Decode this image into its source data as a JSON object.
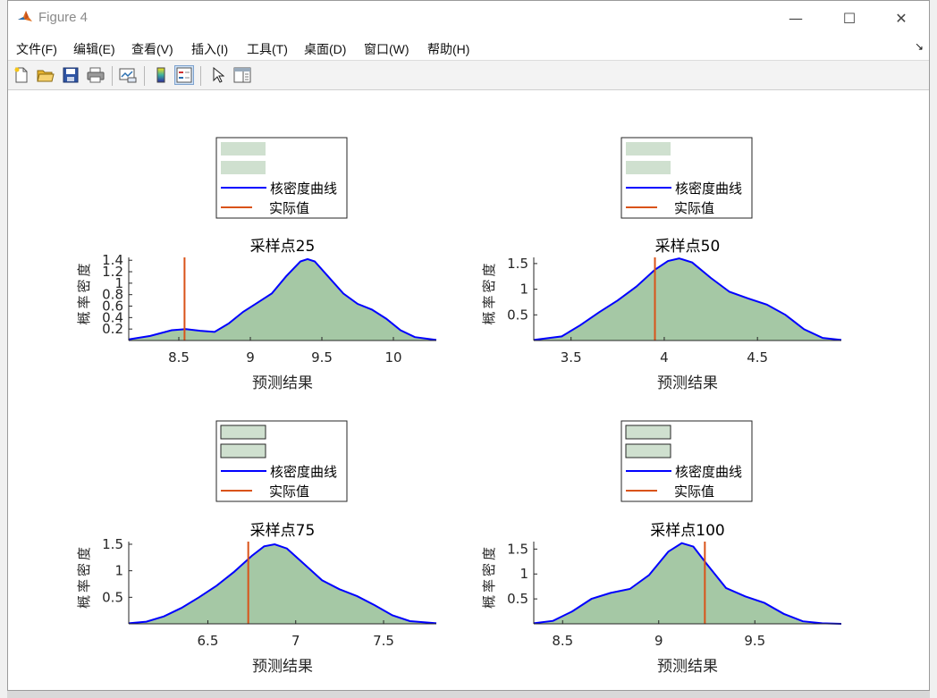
{
  "window": {
    "title": "Figure 4",
    "minimize_glyph": "—",
    "maximize_glyph": "☐",
    "close_glyph": "✕"
  },
  "menu": [
    {
      "label": "文件(F)"
    },
    {
      "label": "编辑(E)"
    },
    {
      "label": "查看(V)"
    },
    {
      "label": "插入(I)"
    },
    {
      "label": "工具(T)"
    },
    {
      "label": "桌面(D)"
    },
    {
      "label": "窗口(W)"
    },
    {
      "label": "帮助(H)"
    }
  ],
  "menu_dock_arrow": "↘",
  "toolbar": [
    {
      "name": "new-figure-icon"
    },
    {
      "name": "open-file-icon"
    },
    {
      "name": "save-icon"
    },
    {
      "name": "print-icon"
    },
    {
      "name": "link-plot-icon"
    },
    {
      "name": "colorbar-icon"
    },
    {
      "name": "legend-icon"
    },
    {
      "name": "pointer-icon"
    },
    {
      "name": "property-inspector-icon"
    }
  ],
  "legend": {
    "kde_label": "核密度曲线",
    "actual_label": "实际值"
  },
  "colors": {
    "kde": "#0000ff",
    "actual": "#d95319",
    "fill": "#a5c8a5",
    "legend_patch": "#cfe0cf"
  },
  "chart_data": [
    {
      "type": "area",
      "title": "采样点25",
      "xlabel": "预测结果",
      "ylabel": "概率密度",
      "xlim": [
        8.15,
        10.3
      ],
      "ylim": [
        0,
        1.45
      ],
      "xticks": [
        8.5,
        9,
        9.5,
        10
      ],
      "xtick_labels": [
        "8.5",
        "9",
        "9.5",
        "10"
      ],
      "yticks": [
        0.2,
        0.4,
        0.6,
        0.8,
        1,
        1.2,
        1.4
      ],
      "ytick_labels": [
        "0.2",
        "0.4",
        "0.6",
        "0.8",
        "1",
        "1.2",
        "1.4"
      ],
      "actual": 8.54,
      "legend_patch_border": false,
      "x": [
        8.15,
        8.3,
        8.45,
        8.55,
        8.65,
        8.75,
        8.85,
        8.95,
        9.05,
        9.15,
        9.25,
        9.35,
        9.4,
        9.45,
        9.55,
        9.65,
        9.75,
        9.85,
        9.95,
        10.05,
        10.15,
        10.3
      ],
      "y": [
        0.02,
        0.08,
        0.18,
        0.2,
        0.17,
        0.15,
        0.3,
        0.5,
        0.66,
        0.82,
        1.12,
        1.38,
        1.42,
        1.38,
        1.1,
        0.82,
        0.64,
        0.54,
        0.38,
        0.18,
        0.06,
        0.01
      ]
    },
    {
      "type": "area",
      "title": "采样点50",
      "xlabel": "预测结果",
      "ylabel": "概率密度",
      "xlim": [
        3.3,
        4.95
      ],
      "ylim": [
        0,
        1.62
      ],
      "xticks": [
        3.5,
        4,
        4.5
      ],
      "xtick_labels": [
        "3.5",
        "4",
        "4.5"
      ],
      "yticks": [
        0.5,
        1,
        1.5
      ],
      "ytick_labels": [
        "0.5",
        "1",
        "1.5"
      ],
      "actual": 3.95,
      "legend_patch_border": false,
      "x": [
        3.3,
        3.45,
        3.55,
        3.65,
        3.75,
        3.85,
        3.95,
        4.02,
        4.08,
        4.15,
        4.25,
        4.35,
        4.45,
        4.55,
        4.65,
        4.75,
        4.85,
        4.95
      ],
      "y": [
        0.01,
        0.08,
        0.3,
        0.55,
        0.78,
        1.05,
        1.38,
        1.55,
        1.6,
        1.52,
        1.22,
        0.95,
        0.82,
        0.7,
        0.5,
        0.22,
        0.05,
        0.01
      ]
    },
    {
      "type": "area",
      "title": "采样点75",
      "xlabel": "预测结果",
      "ylabel": "概率密度",
      "xlim": [
        6.05,
        7.8
      ],
      "ylim": [
        0,
        1.55
      ],
      "xticks": [
        6.5,
        7,
        7.5
      ],
      "xtick_labels": [
        "6.5",
        "7",
        "7.5"
      ],
      "yticks": [
        0.5,
        1,
        1.5
      ],
      "ytick_labels": [
        "0.5",
        "1",
        "1.5"
      ],
      "actual": 6.73,
      "legend_patch_border": true,
      "x": [
        6.05,
        6.15,
        6.25,
        6.35,
        6.45,
        6.55,
        6.65,
        6.75,
        6.82,
        6.88,
        6.95,
        7.05,
        7.15,
        7.25,
        7.35,
        7.45,
        7.55,
        7.65,
        7.8
      ],
      "y": [
        0.01,
        0.04,
        0.14,
        0.3,
        0.5,
        0.72,
        0.98,
        1.28,
        1.46,
        1.5,
        1.42,
        1.12,
        0.82,
        0.65,
        0.52,
        0.35,
        0.16,
        0.05,
        0.01
      ]
    },
    {
      "type": "area",
      "title": "采样点100",
      "xlabel": "预测结果",
      "ylabel": "概率密度",
      "xlim": [
        8.35,
        9.95
      ],
      "ylim": [
        0,
        1.65
      ],
      "xticks": [
        8.5,
        9,
        9.5
      ],
      "xtick_labels": [
        "8.5",
        "9",
        "9.5"
      ],
      "yticks": [
        0.5,
        1,
        1.5
      ],
      "ytick_labels": [
        "0.5",
        "1",
        "1.5"
      ],
      "actual": 9.24,
      "legend_patch_border": true,
      "x": [
        8.35,
        8.45,
        8.55,
        8.65,
        8.75,
        8.85,
        8.95,
        9.05,
        9.12,
        9.18,
        9.25,
        9.35,
        9.45,
        9.55,
        9.65,
        9.75,
        9.85,
        9.95
      ],
      "y": [
        0.01,
        0.06,
        0.25,
        0.5,
        0.62,
        0.7,
        0.98,
        1.45,
        1.62,
        1.55,
        1.2,
        0.72,
        0.55,
        0.42,
        0.2,
        0.05,
        0.01,
        0.0
      ]
    }
  ]
}
